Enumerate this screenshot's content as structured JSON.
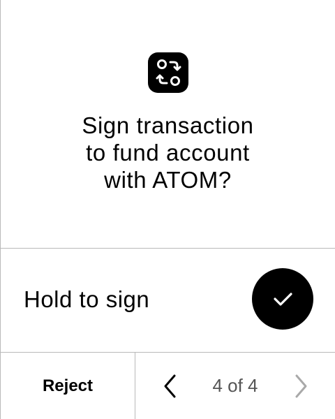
{
  "screen": {
    "icon": "review-swap-icon",
    "title_lines": [
      "Sign transaction",
      "to fund account",
      "with ATOM?"
    ]
  },
  "hold": {
    "label": "Hold to sign",
    "button_icon": "checkmark-icon"
  },
  "footer": {
    "reject_label": "Reject",
    "pager": "4 of 4",
    "prev_icon": "chevron-left-icon",
    "next_icon": "chevron-right-icon"
  },
  "colors": {
    "background": "#ffffff",
    "foreground": "#000000",
    "divider": "#b9b9b9",
    "pager_text": "#555555",
    "disabled_chevron": "#a9a9a9"
  }
}
